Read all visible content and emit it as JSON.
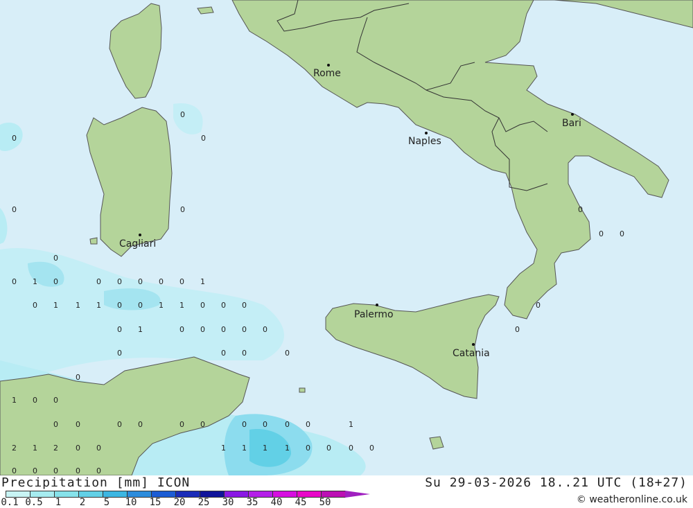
{
  "map": {
    "cities": [
      {
        "name": "Rome"
      },
      {
        "name": "Naples"
      },
      {
        "name": "Bari"
      },
      {
        "name": "Cagliari"
      },
      {
        "name": "Palermo"
      },
      {
        "name": "Catania"
      }
    ],
    "values": [
      "0",
      "0",
      "0",
      "0",
      "0",
      "0",
      "0",
      "0",
      "0",
      "0",
      "1",
      "0",
      "0",
      "0",
      "0",
      "0",
      "0",
      "1",
      "0",
      "1",
      "1",
      "1",
      "0",
      "0",
      "1",
      "1",
      "0",
      "0",
      "0",
      "0",
      "0",
      "1",
      "0",
      "0",
      "0",
      "0",
      "0",
      "0",
      "0",
      "0",
      "0",
      "0",
      "0",
      "1",
      "0",
      "0",
      "0",
      "0",
      "0",
      "0",
      "0",
      "0",
      "0",
      "0",
      "0",
      "0",
      "1",
      "2",
      "1",
      "2",
      "0",
      "0",
      "1",
      "1",
      "1",
      "1",
      "0",
      "0",
      "0",
      "0",
      "0",
      "0",
      "0",
      "0",
      "0"
    ],
    "colors": {
      "sea": "#d8eef8",
      "land": "#b4d49a",
      "precip_light": "#b8ecf4",
      "precip_mid": "#8cdcee",
      "precip_heavy": "#5ccae6"
    }
  },
  "footer": {
    "title": "Precipitation [mm] ICON",
    "datetime": "Su 29-03-2026 18..21 UTC (18+27)",
    "credit": "© weatheronline.co.uk"
  },
  "legend": {
    "labels": [
      "0.1",
      "0.5",
      "1",
      "2",
      "5",
      "10",
      "15",
      "20",
      "25",
      "30",
      "35",
      "40",
      "45",
      "50"
    ],
    "colors": [
      "#c8f4f4",
      "#a6ecf0",
      "#86e2ea",
      "#62d0e6",
      "#3cb6e2",
      "#2c8cdc",
      "#1c5cd4",
      "#1a2cb8",
      "#10149a",
      "#8a18e4",
      "#b420e8",
      "#d60ee0",
      "#e808c8",
      "#bc10b4"
    ]
  }
}
